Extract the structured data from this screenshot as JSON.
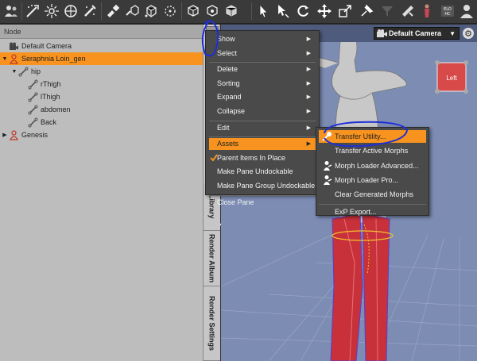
{
  "toolbar": {
    "icons": [
      "people-icon",
      "transform-icon",
      "universal-icon",
      "node-weight-icon",
      "pose-tool-icon",
      "surface-brush-icon",
      "geometry-editor-icon",
      "joint-editor-icon",
      "region-icon",
      "cube-select-icon",
      "cube-move-icon",
      "cursor-icon",
      "translate-icon",
      "rotate-icon",
      "move-arrows-icon",
      "scale-icon",
      "pin-icon",
      "funnel-icon",
      "render-icon",
      "figure-icon",
      "iray-icon",
      "avatar-icon"
    ]
  },
  "scene": {
    "header": "Node",
    "rows": [
      {
        "label": "Default Camera",
        "icon": "camera-icon",
        "indent": 0,
        "arrow": ""
      },
      {
        "label": "Seraphnia Loin_gen",
        "icon": "figure-icon",
        "indent": 0,
        "arrow": "▼",
        "selected": true
      },
      {
        "label": "hip",
        "icon": "bone-icon",
        "indent": 1,
        "arrow": "▼"
      },
      {
        "label": "rThigh",
        "icon": "bone-icon",
        "indent": 2,
        "arrow": ""
      },
      {
        "label": "lThigh",
        "icon": "bone-icon",
        "indent": 2,
        "arrow": ""
      },
      {
        "label": "abdomen",
        "icon": "bone-icon",
        "indent": 2,
        "arrow": ""
      },
      {
        "label": "Back",
        "icon": "bone-icon",
        "indent": 2,
        "arrow": ""
      },
      {
        "label": "Genesis",
        "icon": "figure-icon",
        "indent": 0,
        "arrow": "▶"
      }
    ]
  },
  "side_tabs": [
    "Library",
    "Render Album",
    "Render Settings"
  ],
  "viewport": {
    "camera": "Default Camera",
    "cube_label": "Left"
  },
  "context_menu": {
    "items": [
      {
        "label": "Show",
        "submenu": true
      },
      {
        "label": "Select",
        "submenu": true
      },
      {
        "sep": true
      },
      {
        "label": "Delete",
        "submenu": true
      },
      {
        "label": "Sorting",
        "submenu": true
      },
      {
        "label": "Expand",
        "submenu": true
      },
      {
        "label": "Collapse",
        "submenu": true
      },
      {
        "sep": true
      },
      {
        "label": "Edit",
        "submenu": true
      },
      {
        "sep": true
      },
      {
        "label": "Assets",
        "submenu": true,
        "highlight": true
      },
      {
        "label": "Parent Items In Place",
        "checked": true
      },
      {
        "label": "Make Pane Undockable"
      },
      {
        "label": "Make Pane Group Undockable"
      },
      {
        "sep": true
      },
      {
        "label": "Close Pane"
      }
    ]
  },
  "assets_submenu": {
    "items": [
      {
        "label": "Transfer Utility...",
        "highlight": true,
        "icon": "transfer-icon"
      },
      {
        "label": "Transfer Active Morphs"
      },
      {
        "label": "Morph Loader Advanced...",
        "icon": "morph-icon"
      },
      {
        "label": "Morph Loader Pro...",
        "icon": "morph-icon"
      },
      {
        "label": "Clear Generated Morphs"
      },
      {
        "sep": true
      },
      {
        "label": "ExP Export..."
      }
    ]
  },
  "colors": {
    "highlight": "#f7931e",
    "annotation": "#1e2fd6",
    "menu_bg": "#4a4a4a",
    "viewport_bg": "#7c8cb3"
  }
}
